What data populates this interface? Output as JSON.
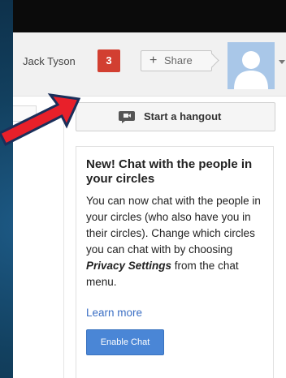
{
  "header": {
    "user_name": "Jack Tyson",
    "notification_count": "3",
    "share_label": "Share"
  },
  "sidebar": {
    "hangout_button_label": "Start a hangout"
  },
  "chat_promo": {
    "title": "New! Chat with the people in your circles",
    "body_part1": "You can now chat with the people in your circles (who also have you in their circles). Change which circles you can chat with by choosing ",
    "body_emphasis": "Privacy Settings",
    "body_part2": " from the chat menu.",
    "learn_more_label": "Learn more",
    "enable_button_label": "Enable Chat"
  },
  "colors": {
    "notification_badge": "#d23f31",
    "enable_button": "#4a86d6",
    "link": "#3b6fc4",
    "annotation_arrow": "#e8202a"
  }
}
